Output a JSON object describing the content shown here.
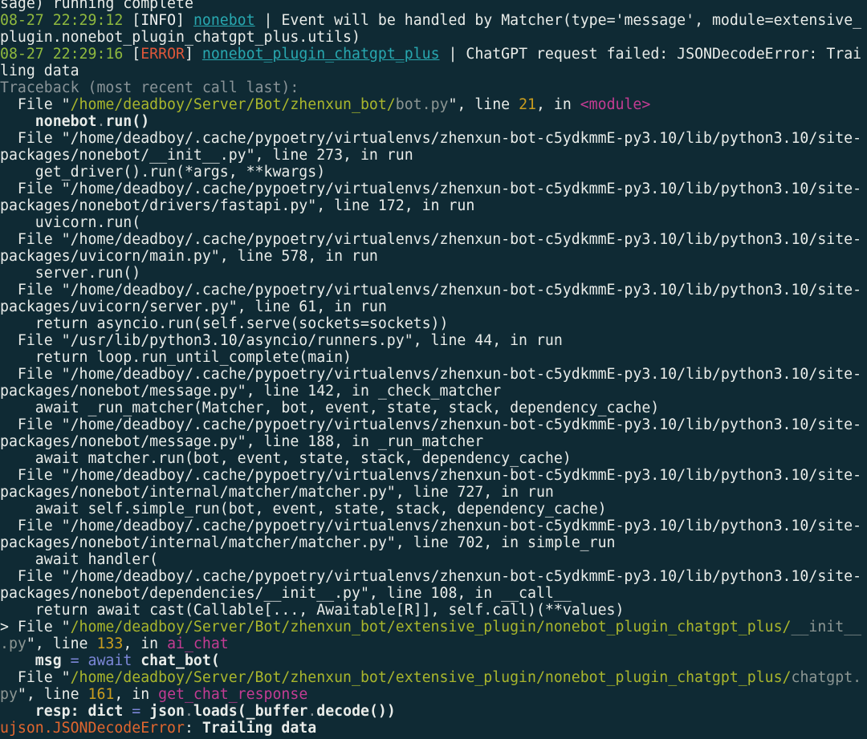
{
  "terminal": {
    "lines": [
      [
        {
          "t": "sage) running complete"
        }
      ],
      [
        {
          "t": "08-27 22:29:12",
          "c": "time"
        },
        {
          "t": " ["
        },
        {
          "t": "INFO",
          "c": "info"
        },
        {
          "t": "] "
        },
        {
          "t": "nonebot",
          "c": "mod"
        },
        {
          "t": " | Event will be handled by Matcher(type='message', module=extensive_"
        }
      ],
      [
        {
          "t": "plugin.nonebot_plugin_chatgpt_plus.utils)"
        }
      ],
      [
        {
          "t": "08-27 22:29:16",
          "c": "time"
        },
        {
          "t": " ["
        },
        {
          "t": "ERROR",
          "c": "error"
        },
        {
          "t": "] "
        },
        {
          "t": "nonebot_plugin_chatgpt_plus",
          "c": "mod"
        },
        {
          "t": " | ChatGPT request failed: JSONDecodeError: Trai"
        }
      ],
      [
        {
          "t": "ling data"
        }
      ],
      [
        {
          "t": "Traceback (most recent call last):",
          "c": "dim"
        }
      ],
      [
        {
          "t": "  File \""
        },
        {
          "t": "/home/deadboy/Server/Bot/zhenxun_bot/",
          "c": "path"
        },
        {
          "t": "bot.py",
          "c": "pathdim"
        },
        {
          "t": "\", line "
        },
        {
          "t": "21",
          "c": "num"
        },
        {
          "t": ", in "
        },
        {
          "t": "<module>",
          "c": "fn"
        }
      ],
      [
        {
          "t": "    nonebot",
          "c": "bold"
        },
        {
          "t": ".",
          "c": "dim"
        },
        {
          "t": "run()",
          "c": "bold"
        }
      ],
      [
        {
          "t": "  File \"/home/deadboy/.cache/pypoetry/virtualenvs/zhenxun-bot-c5ydkmmE-py3.10/lib/python3.10/site-"
        }
      ],
      [
        {
          "t": "packages/nonebot/__init__.py\", line 273, in run"
        }
      ],
      [
        {
          "t": "    get_driver().run(*args, **kwargs)"
        }
      ],
      [
        {
          "t": "  File \"/home/deadboy/.cache/pypoetry/virtualenvs/zhenxun-bot-c5ydkmmE-py3.10/lib/python3.10/site-"
        }
      ],
      [
        {
          "t": "packages/nonebot/drivers/fastapi.py\", line 172, in run"
        }
      ],
      [
        {
          "t": "    uvicorn.run("
        }
      ],
      [
        {
          "t": "  File \"/home/deadboy/.cache/pypoetry/virtualenvs/zhenxun-bot-c5ydkmmE-py3.10/lib/python3.10/site-"
        }
      ],
      [
        {
          "t": "packages/uvicorn/main.py\", line 578, in run"
        }
      ],
      [
        {
          "t": "    server.run()"
        }
      ],
      [
        {
          "t": "  File \"/home/deadboy/.cache/pypoetry/virtualenvs/zhenxun-bot-c5ydkmmE-py3.10/lib/python3.10/site-"
        }
      ],
      [
        {
          "t": "packages/uvicorn/server.py\", line 61, in run"
        }
      ],
      [
        {
          "t": "    return asyncio.run(self.serve(sockets=sockets))"
        }
      ],
      [
        {
          "t": "  File \"/usr/lib/python3.10/asyncio/runners.py\", line 44, in run"
        }
      ],
      [
        {
          "t": "    return loop.run_until_complete(main)"
        }
      ],
      [
        {
          "t": "  File \"/home/deadboy/.cache/pypoetry/virtualenvs/zhenxun-bot-c5ydkmmE-py3.10/lib/python3.10/site-"
        }
      ],
      [
        {
          "t": "packages/nonebot/message.py\", line 142, in _check_matcher"
        }
      ],
      [
        {
          "t": "    await _run_matcher(Matcher, bot, event, state, stack, dependency_cache)"
        }
      ],
      [
        {
          "t": "  File \"/home/deadboy/.cache/pypoetry/virtualenvs/zhenxun-bot-c5ydkmmE-py3.10/lib/python3.10/site-"
        }
      ],
      [
        {
          "t": "packages/nonebot/message.py\", line 188, in _run_matcher"
        }
      ],
      [
        {
          "t": "    await matcher.run(bot, event, state, stack, dependency_cache)"
        }
      ],
      [
        {
          "t": "  File \"/home/deadboy/.cache/pypoetry/virtualenvs/zhenxun-bot-c5ydkmmE-py3.10/lib/python3.10/site-"
        }
      ],
      [
        {
          "t": "packages/nonebot/internal/matcher/matcher.py\", line 727, in run"
        }
      ],
      [
        {
          "t": "    await self.simple_run(bot, event, state, stack, dependency_cache)"
        }
      ],
      [
        {
          "t": "  File \"/home/deadboy/.cache/pypoetry/virtualenvs/zhenxun-bot-c5ydkmmE-py3.10/lib/python3.10/site-"
        }
      ],
      [
        {
          "t": "packages/nonebot/internal/matcher/matcher.py\", line 702, in simple_run"
        }
      ],
      [
        {
          "t": "    await handler("
        }
      ],
      [
        {
          "t": "  File \"/home/deadboy/.cache/pypoetry/virtualenvs/zhenxun-bot-c5ydkmmE-py3.10/lib/python3.10/site-"
        }
      ],
      [
        {
          "t": "packages/nonebot/dependencies/__init__.py\", line 108, in __call__"
        }
      ],
      [
        {
          "t": "    return await cast(Callable[..., Awaitable[R]], self.call)(**values)"
        }
      ],
      [
        {
          "t": "> File \""
        },
        {
          "t": "/home/deadboy/Server/Bot/zhenxun_bot/extensive_plugin/nonebot_plugin_chatgpt_plus/",
          "c": "path"
        },
        {
          "t": "__init__",
          "c": "pathdim"
        }
      ],
      [
        {
          "t": ".py",
          "c": "pathdim"
        },
        {
          "t": "\", line "
        },
        {
          "t": "133",
          "c": "num"
        },
        {
          "t": ", in "
        },
        {
          "t": "ai_chat",
          "c": "fn"
        }
      ],
      [
        {
          "t": "    msg ",
          "c": "bold"
        },
        {
          "t": "=",
          "c": "kw"
        },
        {
          "t": " "
        },
        {
          "t": "await",
          "c": "kw"
        },
        {
          "t": " chat_bot(",
          "c": "bold"
        }
      ],
      [
        {
          "t": "  File \""
        },
        {
          "t": "/home/deadboy/Server/Bot/zhenxun_bot/extensive_plugin/nonebot_plugin_chatgpt_plus/",
          "c": "path"
        },
        {
          "t": "chatgpt.",
          "c": "pathdim"
        }
      ],
      [
        {
          "t": "py",
          "c": "pathdim"
        },
        {
          "t": "\", line "
        },
        {
          "t": "161",
          "c": "num"
        },
        {
          "t": ", in "
        },
        {
          "t": "get_chat_response",
          "c": "fn"
        }
      ],
      [
        {
          "t": "    resp",
          "c": "bold"
        },
        {
          "t": ": ",
          "c": "bold"
        },
        {
          "t": "dict",
          "c": "bold"
        },
        {
          "t": " "
        },
        {
          "t": "=",
          "c": "kw"
        },
        {
          "t": " "
        },
        {
          "t": "json",
          "c": "bold"
        },
        {
          "t": ".",
          "c": "dim"
        },
        {
          "t": "loads(_buffer",
          "c": "bold"
        },
        {
          "t": ".",
          "c": "dim"
        },
        {
          "t": "decode())",
          "c": "bold"
        }
      ],
      [
        {
          "t": "ujson.JSONDecodeError",
          "c": "exc"
        },
        {
          "t": ": "
        },
        {
          "t": "Trailing data",
          "c": "bold"
        }
      ]
    ]
  }
}
